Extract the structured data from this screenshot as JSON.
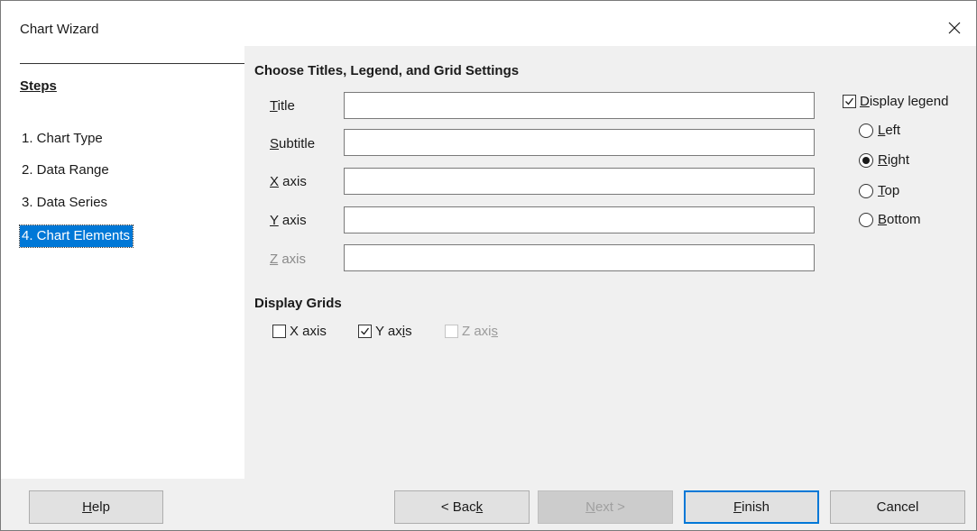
{
  "window": {
    "title": "Chart Wizard"
  },
  "steps": {
    "heading": "Steps",
    "items": [
      {
        "label": "1. Chart Type",
        "active": false
      },
      {
        "label": "2. Data Range",
        "active": false
      },
      {
        "label": "3. Data Series",
        "active": false
      },
      {
        "label": "4. Chart Elements",
        "active": true
      }
    ]
  },
  "main": {
    "section_title": "Choose Titles, Legend, and Grid Settings",
    "fields": {
      "title": {
        "label_key": "T",
        "label_rest": "itle",
        "value": ""
      },
      "subtitle": {
        "label_key": "S",
        "label_rest": "ubtitle",
        "value": ""
      },
      "x_axis": {
        "label_key": "X",
        "label_rest": " axis",
        "value": ""
      },
      "y_axis": {
        "label_key": "Y",
        "label_rest": " axis",
        "value": ""
      },
      "z_axis": {
        "label_key": "Z",
        "label_rest": " axis",
        "value": "",
        "disabled": true
      }
    },
    "legend": {
      "display_label_key": "D",
      "display_label_rest": "isplay legend",
      "checked": true,
      "options": [
        {
          "key": "L",
          "rest": "eft",
          "selected": false
        },
        {
          "key": "R",
          "rest": "ight",
          "selected": true
        },
        {
          "key": "T",
          "rest": "op",
          "selected": false
        },
        {
          "key": "B",
          "rest": "ottom",
          "selected": false
        }
      ]
    },
    "grids": {
      "title": "Display Grids",
      "x": {
        "label": "X axis",
        "checked": false
      },
      "y": {
        "pre": "Y ax",
        "key": "i",
        "post": "s",
        "checked": true
      },
      "z": {
        "pre": "Z axi",
        "key": "s",
        "checked": false,
        "disabled": true
      }
    }
  },
  "buttons": {
    "help": {
      "key": "H",
      "rest": "elp"
    },
    "back": {
      "pre": "< Bac",
      "key": "k"
    },
    "next": {
      "key": "N",
      "rest": "ext >"
    },
    "finish": {
      "key": "F",
      "rest": "inish"
    },
    "cancel": "Cancel"
  }
}
